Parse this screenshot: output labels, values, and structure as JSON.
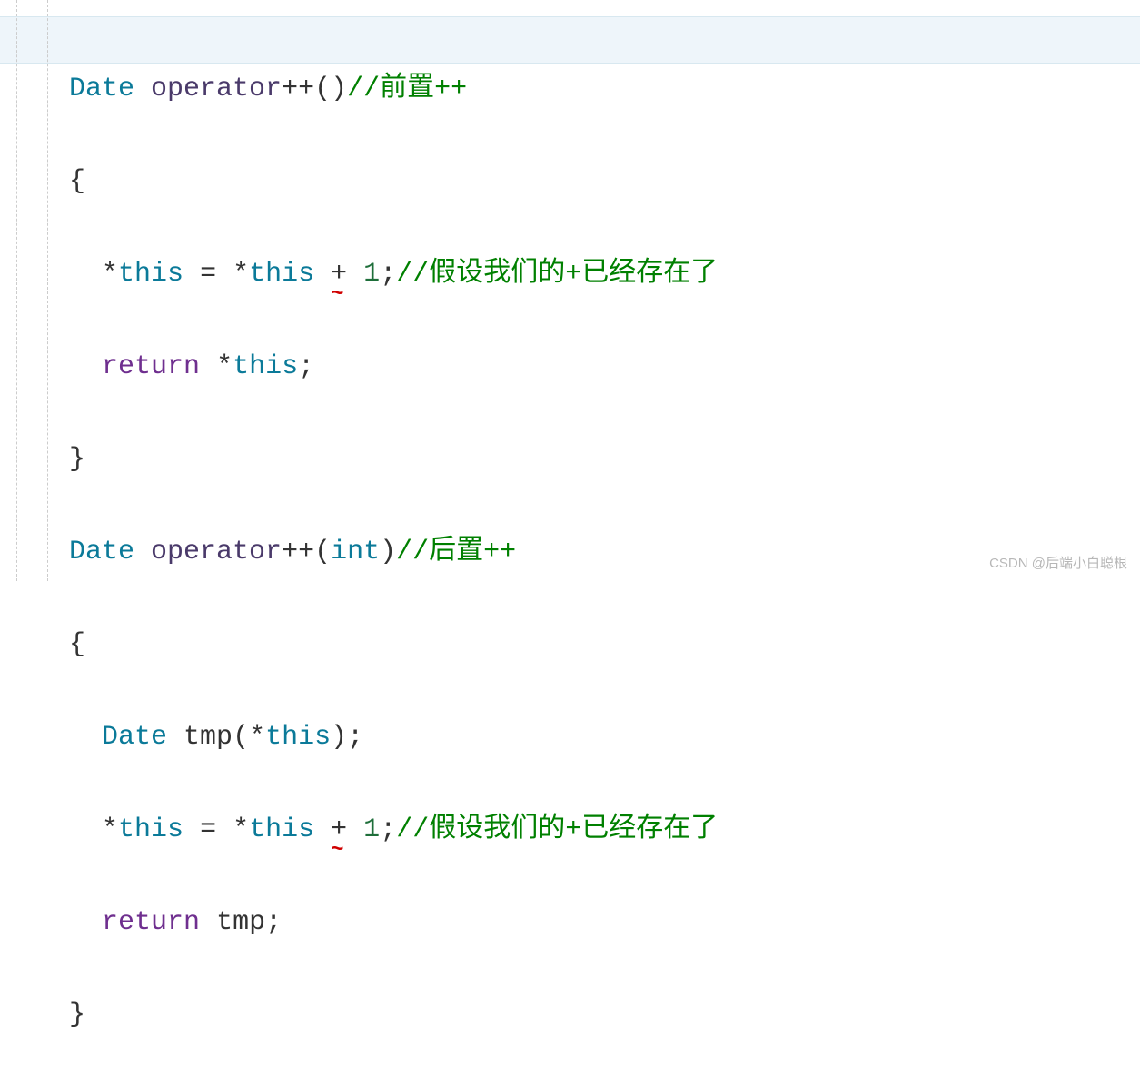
{
  "code": {
    "tokens": {
      "date": "Date",
      "operator": "operator",
      "int": "int",
      "return": "return",
      "this": "this",
      "tmp": "tmp",
      "plus": "+",
      "one": "1",
      "star": "*",
      "eq": "=",
      "semi": ";",
      "lparen": "(",
      "rparen": ")",
      "lbrace": "{",
      "rbrace": "}",
      "plusplus": "++"
    },
    "comments": {
      "prefix_inc": "//前置++",
      "postfix_inc": "//后置++",
      "assume_plus": "//假设我们的+已经存在了"
    }
  },
  "watermark": "CSDN @后端小白聪根"
}
